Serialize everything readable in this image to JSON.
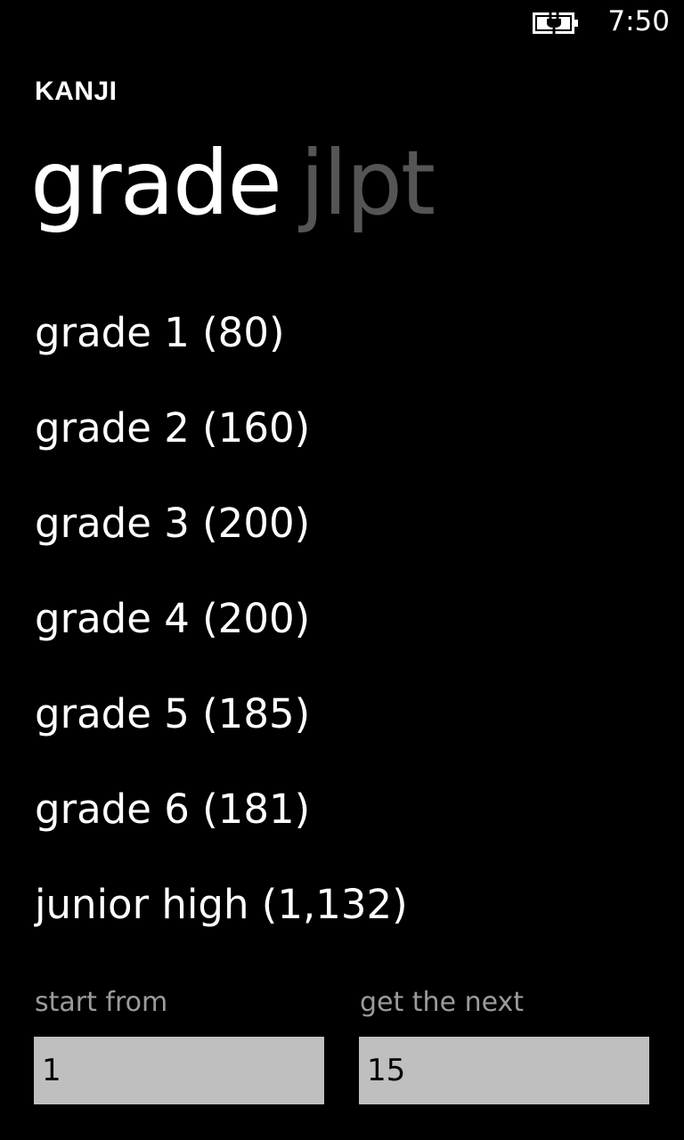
{
  "status_bar": {
    "time": "7:50",
    "battery_icon": "battery-charging-icon"
  },
  "app": {
    "title": "KANJI"
  },
  "pivot": {
    "active": "grade",
    "inactive": "jlpt"
  },
  "grades": [
    {
      "label": "grade 1 (80)"
    },
    {
      "label": "grade 2 (160)"
    },
    {
      "label": "grade 3 (200)"
    },
    {
      "label": "grade 4 (200)"
    },
    {
      "label": "grade 5 (185)"
    },
    {
      "label": "grade 6 (181)"
    },
    {
      "label": "junior high (1,132)"
    }
  ],
  "inputs": {
    "start_label": "start from",
    "start_value": "1",
    "next_label": "get the next",
    "next_value": "15"
  },
  "colors": {
    "background": "#000000",
    "text": "#ffffff",
    "inactive_pivot": "#555555",
    "field_label": "#9b9b9b",
    "input_background": "#bfbfbf"
  }
}
